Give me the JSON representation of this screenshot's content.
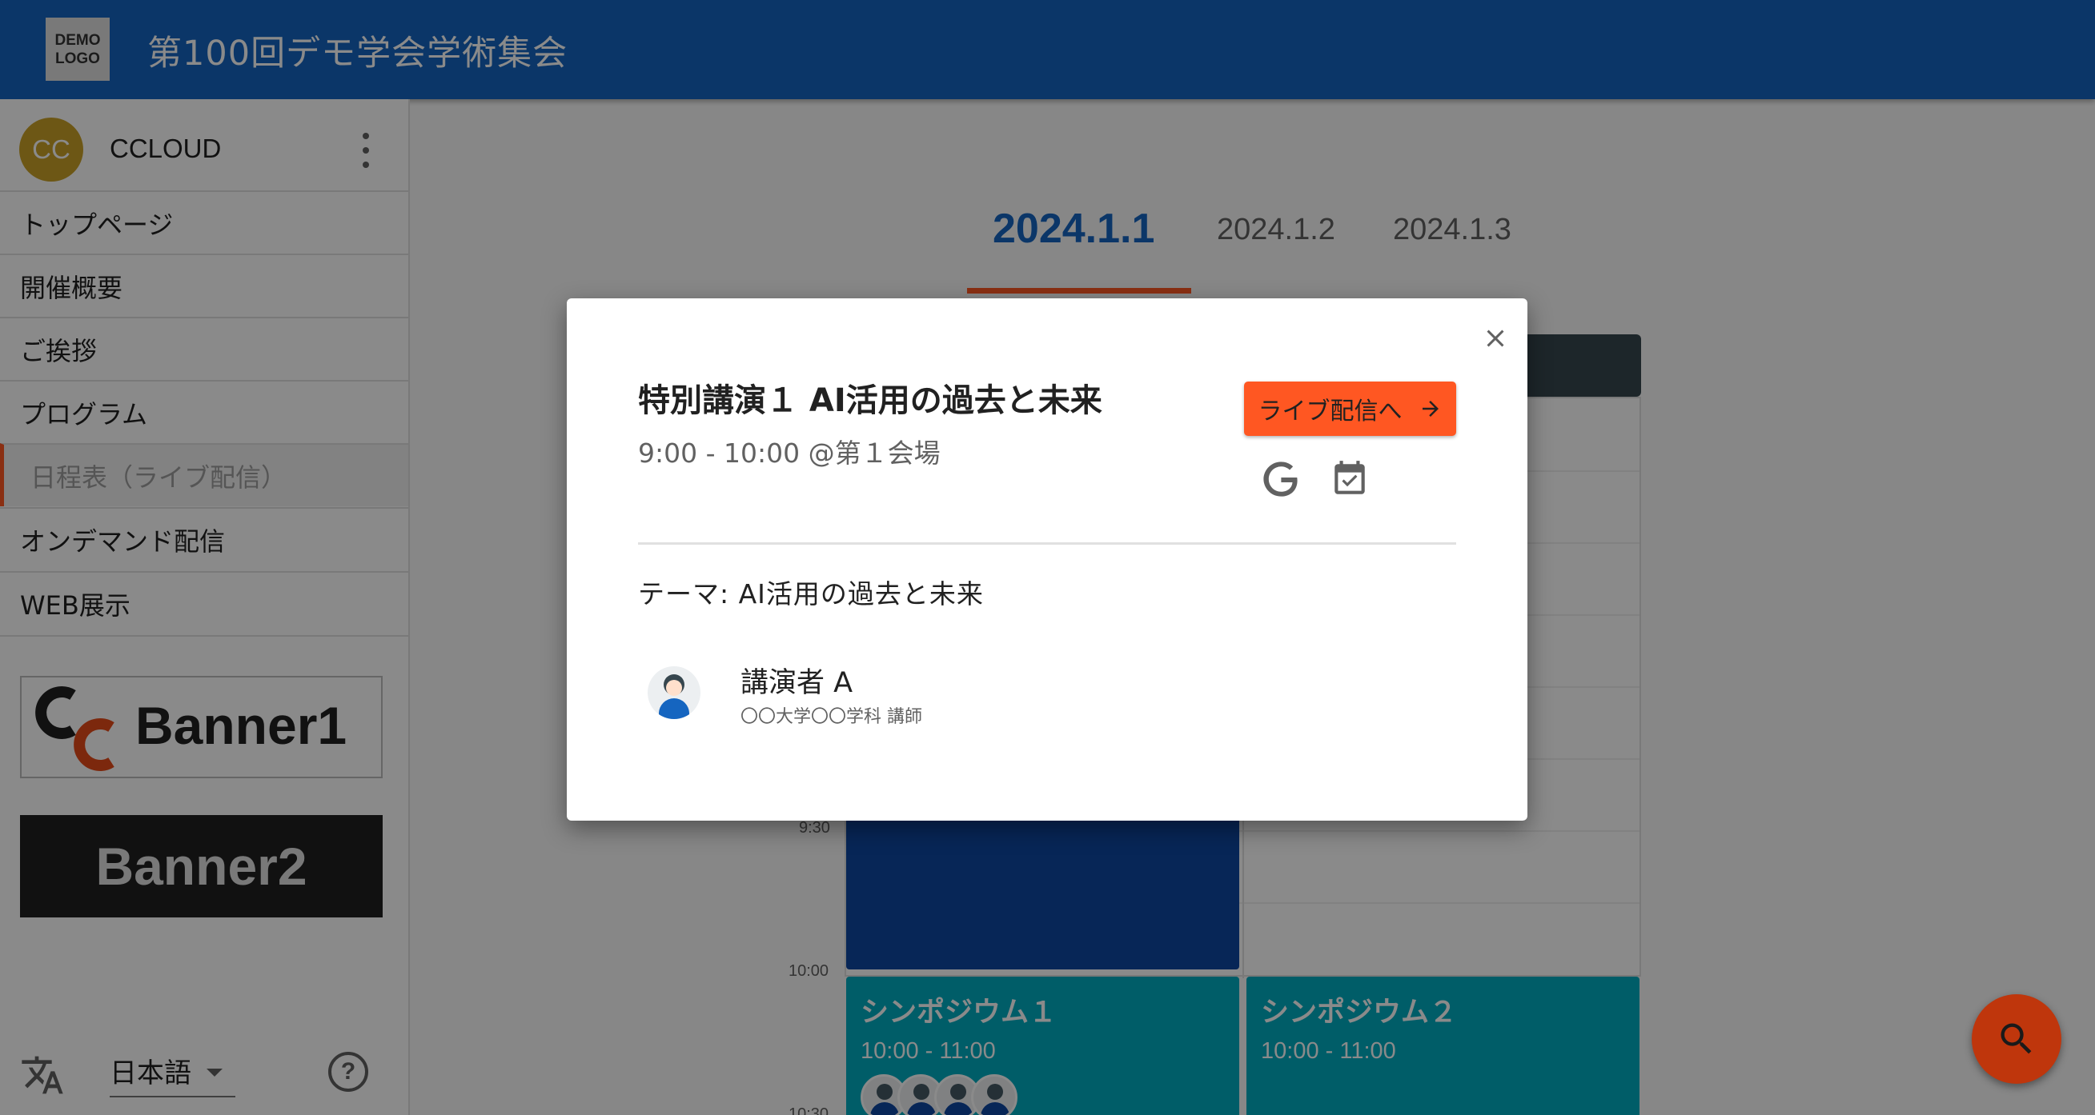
{
  "header": {
    "logo_line1": "DEMO",
    "logo_line2": "LOGO",
    "title": "第100回デモ学会学術集会",
    "color": "#1565c0"
  },
  "sidebar": {
    "user": {
      "initials": "CC",
      "name": "CCLOUD"
    },
    "items": [
      {
        "label": "トップページ"
      },
      {
        "label": "開催概要"
      },
      {
        "label": "ご挨拶"
      },
      {
        "label": "プログラム"
      },
      {
        "label": "日程表（ライブ配信）",
        "active": true
      },
      {
        "label": "オンデマンド配信"
      },
      {
        "label": "WEB展示"
      }
    ],
    "banners": [
      {
        "label": "Banner1"
      },
      {
        "label": "Banner2"
      }
    ],
    "language": "日本語",
    "help": "?"
  },
  "main": {
    "date_tabs": [
      {
        "label": "2024.1.1",
        "active": true
      },
      {
        "label": "2024.1.2"
      },
      {
        "label": "2024.1.3"
      }
    ],
    "time_labels": [
      "9:30",
      "10:00",
      "10:30"
    ],
    "sessions": [
      {
        "title": "シンポジウム１",
        "time": "10:00 - 11:00"
      },
      {
        "title": "シンポジウム２",
        "time": "10:00 - 11:00"
      }
    ]
  },
  "dialog": {
    "title": "特別講演１ AI活用の過去と未来",
    "subtitle": "9:00 - 10:00  @第１会場",
    "live_button_label": "ライブ配信へ",
    "theme": "テーマ: AI活用の過去と未来",
    "speaker": {
      "name": "講演者 A",
      "affiliation": "〇〇大学〇〇学科 講師"
    }
  },
  "colors": {
    "accent": "#ff5722",
    "primary": "#1565c0",
    "teal": "#00acc1",
    "fab": "#bf360c"
  },
  "icons": [
    "close-icon",
    "arrow-right-icon",
    "google-icon",
    "calendar-check-icon",
    "translate-icon",
    "help-icon",
    "search-icon",
    "more-vert-icon"
  ]
}
